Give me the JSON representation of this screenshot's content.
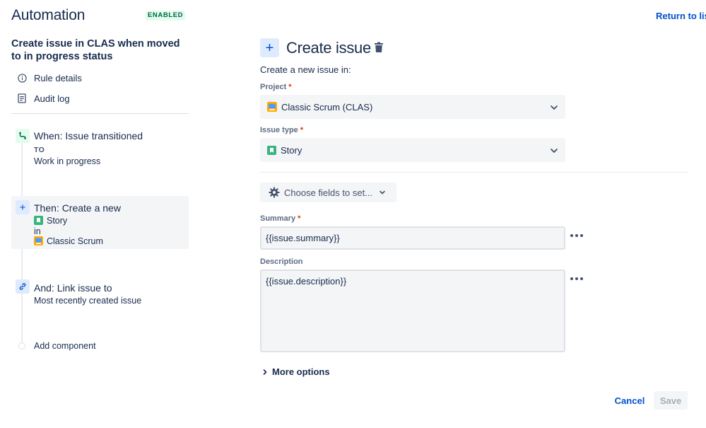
{
  "header": {
    "title": "Automation",
    "status_badge": "ENABLED",
    "return_link": "Return to list"
  },
  "rule": {
    "name": "Create issue in CLAS when moved to in progress status"
  },
  "nav": {
    "rule_details": "Rule details",
    "audit_log": "Audit log"
  },
  "components": {
    "trigger": {
      "title": "When: Issue transitioned",
      "to_label": "TO",
      "value": "Work in progress"
    },
    "action": {
      "title": "Then: Create a new",
      "issue_type": "Story",
      "in_label": "in",
      "project": "Classic Scrum"
    },
    "link": {
      "title": "And: Link issue to",
      "value": "Most recently created issue"
    },
    "add": "Add component"
  },
  "panel": {
    "title": "Create issue",
    "subtitle": "Create a new issue in:",
    "project_label": "Project",
    "project_value": "Classic Scrum (CLAS)",
    "issue_type_label": "Issue type",
    "issue_type_value": "Story",
    "choose_fields": "Choose fields to set...",
    "summary_label": "Summary",
    "summary_value": "{{issue.summary}}",
    "description_label": "Description",
    "description_value": "{{issue.description}}",
    "more_options": "More options",
    "required_mark": "*"
  },
  "footer": {
    "cancel": "Cancel",
    "save": "Save"
  },
  "colors": {
    "primary": "#0052CC",
    "text": "#172B4D",
    "story_green": "#36B37E",
    "trigger_bg": "#E3FCEF",
    "action_bg": "#DEEBFF",
    "required": "#DE350B"
  }
}
